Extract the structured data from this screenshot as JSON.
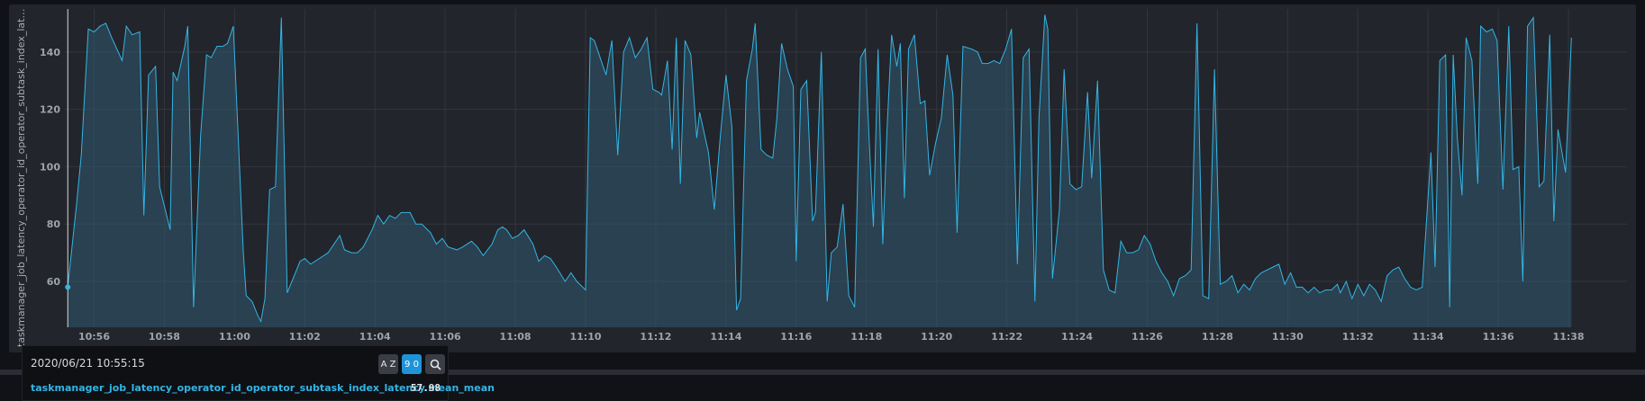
{
  "colors": {
    "line": "#33b5e5",
    "fill": "#2f5a70",
    "grid": "#33363d",
    "background": "#22252b"
  },
  "chart_data": {
    "type": "area",
    "title": "",
    "xlabel": "",
    "ylabel": "taskmanager_job_latency_operator_id_operator_subtask_index_latency.m...",
    "x_ticks": [
      "10:56",
      "10:58",
      "11:00",
      "11:02",
      "11:04",
      "11:06",
      "11:08",
      "11:10",
      "11:12",
      "11:14",
      "11:16",
      "11:18",
      "11:20",
      "11:22",
      "11:24",
      "11:26",
      "11:28",
      "11:30",
      "11:32",
      "11:34",
      "11:36",
      "11:38"
    ],
    "y_ticks": [
      60,
      80,
      100,
      120,
      140
    ],
    "ylim": [
      44,
      155
    ],
    "xlim": [
      "10:55:10",
      "11:39:40"
    ],
    "grid": true,
    "series": [
      {
        "name": "taskmanager_job_latency_operator_id_operator_subtask_index_latency.mean_mean",
        "points": [
          [
            "10:55:15",
            58
          ],
          [
            "10:55:30",
            87
          ],
          [
            "10:55:38",
            104
          ],
          [
            "10:55:50",
            148
          ],
          [
            "10:56:00",
            147
          ],
          [
            "10:56:10",
            149
          ],
          [
            "10:56:20",
            150
          ],
          [
            "10:56:30",
            145
          ],
          [
            "10:56:48",
            137
          ],
          [
            "10:56:55",
            149
          ],
          [
            "10:57:05",
            146
          ],
          [
            "10:57:18",
            147
          ],
          [
            "10:57:25",
            83
          ],
          [
            "10:57:33",
            132
          ],
          [
            "10:57:45",
            135
          ],
          [
            "10:57:52",
            93
          ],
          [
            "10:58:10",
            78
          ],
          [
            "10:58:15",
            133
          ],
          [
            "10:58:22",
            130
          ],
          [
            "10:58:35",
            142
          ],
          [
            "10:58:40",
            149
          ],
          [
            "10:58:50",
            51
          ],
          [
            "10:59:02",
            111
          ],
          [
            "10:59:12",
            139
          ],
          [
            "10:59:20",
            138
          ],
          [
            "10:59:30",
            142
          ],
          [
            "10:59:40",
            142
          ],
          [
            "10:59:48",
            143
          ],
          [
            "10:59:58",
            149
          ],
          [
            "11:00:15",
            70
          ],
          [
            "11:00:20",
            55
          ],
          [
            "11:00:30",
            53
          ],
          [
            "11:00:40",
            48
          ],
          [
            "11:00:45",
            46
          ],
          [
            "11:00:52",
            54
          ],
          [
            "11:01:00",
            92
          ],
          [
            "11:01:10",
            93
          ],
          [
            "11:01:20",
            152
          ],
          [
            "11:01:30",
            56
          ],
          [
            "11:01:40",
            61
          ],
          [
            "11:01:52",
            67
          ],
          [
            "11:02:00",
            68
          ],
          [
            "11:02:10",
            66
          ],
          [
            "11:02:25",
            68
          ],
          [
            "11:02:40",
            70
          ],
          [
            "11:03:00",
            76
          ],
          [
            "11:03:08",
            71
          ],
          [
            "11:03:20",
            70
          ],
          [
            "11:03:30",
            70
          ],
          [
            "11:03:40",
            72
          ],
          [
            "11:03:55",
            78
          ],
          [
            "11:04:05",
            83
          ],
          [
            "11:04:15",
            80
          ],
          [
            "11:04:25",
            83
          ],
          [
            "11:04:35",
            82
          ],
          [
            "11:04:45",
            84
          ],
          [
            "11:05:00",
            84
          ],
          [
            "11:05:10",
            80
          ],
          [
            "11:05:20",
            80
          ],
          [
            "11:05:35",
            77
          ],
          [
            "11:05:45",
            73
          ],
          [
            "11:05:55",
            75
          ],
          [
            "11:06:05",
            72
          ],
          [
            "11:06:20",
            71
          ],
          [
            "11:06:30",
            72
          ],
          [
            "11:06:45",
            74
          ],
          [
            "11:06:55",
            72
          ],
          [
            "11:07:05",
            69
          ],
          [
            "11:07:20",
            73
          ],
          [
            "11:07:30",
            78
          ],
          [
            "11:07:38",
            79
          ],
          [
            "11:07:45",
            78
          ],
          [
            "11:07:55",
            75
          ],
          [
            "11:08:05",
            76
          ],
          [
            "11:08:15",
            78
          ],
          [
            "11:08:30",
            73
          ],
          [
            "11:08:40",
            67
          ],
          [
            "11:08:50",
            69
          ],
          [
            "11:09:00",
            68
          ],
          [
            "11:09:10",
            65
          ],
          [
            "11:09:25",
            60
          ],
          [
            "11:09:35",
            63
          ],
          [
            "11:09:45",
            60
          ],
          [
            "11:10:00",
            57
          ],
          [
            "11:10:08",
            145
          ],
          [
            "11:10:15",
            144
          ],
          [
            "11:10:25",
            138
          ],
          [
            "11:10:35",
            132
          ],
          [
            "11:10:45",
            144
          ],
          [
            "11:10:55",
            104
          ],
          [
            "11:11:05",
            140
          ],
          [
            "11:11:15",
            145
          ],
          [
            "11:11:25",
            138
          ],
          [
            "11:11:35",
            141
          ],
          [
            "11:11:45",
            145
          ],
          [
            "11:11:55",
            127
          ],
          [
            "11:12:05",
            126
          ],
          [
            "11:12:10",
            125
          ],
          [
            "11:12:20",
            137
          ],
          [
            "11:12:28",
            106
          ],
          [
            "11:12:35",
            145
          ],
          [
            "11:12:42",
            94
          ],
          [
            "11:12:50",
            144
          ],
          [
            "11:13:00",
            139
          ],
          [
            "11:13:10",
            110
          ],
          [
            "11:13:15",
            119
          ],
          [
            "11:13:30",
            105
          ],
          [
            "11:13:40",
            85
          ],
          [
            "11:13:50",
            110
          ],
          [
            "11:14:00",
            132
          ],
          [
            "11:14:10",
            114
          ],
          [
            "11:14:18",
            50
          ],
          [
            "11:14:25",
            54
          ],
          [
            "11:14:35",
            130
          ],
          [
            "11:14:45",
            141
          ],
          [
            "11:14:50",
            150
          ],
          [
            "11:15:00",
            106
          ],
          [
            "11:15:10",
            104
          ],
          [
            "11:15:20",
            103
          ],
          [
            "11:15:27",
            117
          ],
          [
            "11:15:35",
            143
          ],
          [
            "11:15:45",
            134
          ],
          [
            "11:15:55",
            128
          ],
          [
            "11:16:00",
            67
          ],
          [
            "11:16:08",
            127
          ],
          [
            "11:16:18",
            130
          ],
          [
            "11:16:28",
            81
          ],
          [
            "11:16:33",
            84
          ],
          [
            "11:16:43",
            140
          ],
          [
            "11:16:53",
            53
          ],
          [
            "11:17:00",
            70
          ],
          [
            "11:17:10",
            72
          ],
          [
            "11:17:20",
            87
          ],
          [
            "11:17:30",
            55
          ],
          [
            "11:17:40",
            51
          ],
          [
            "11:17:50",
            138
          ],
          [
            "11:17:58",
            141
          ],
          [
            "11:18:05",
            108
          ],
          [
            "11:18:12",
            79
          ],
          [
            "11:18:20",
            141
          ],
          [
            "11:18:28",
            73
          ],
          [
            "11:18:35",
            112
          ],
          [
            "11:18:43",
            146
          ],
          [
            "11:18:52",
            135
          ],
          [
            "11:18:58",
            143
          ],
          [
            "11:19:05",
            89
          ],
          [
            "11:19:12",
            141
          ],
          [
            "11:19:22",
            146
          ],
          [
            "11:19:32",
            122
          ],
          [
            "11:19:40",
            123
          ],
          [
            "11:19:48",
            97
          ],
          [
            "11:19:58",
            108
          ],
          [
            "11:20:08",
            117
          ],
          [
            "11:20:18",
            139
          ],
          [
            "11:20:28",
            125
          ],
          [
            "11:20:35",
            77
          ],
          [
            "11:20:45",
            142
          ],
          [
            "11:21:00",
            141
          ],
          [
            "11:21:10",
            140
          ],
          [
            "11:21:18",
            136
          ],
          [
            "11:21:28",
            136
          ],
          [
            "11:21:38",
            137
          ],
          [
            "11:21:48",
            136
          ],
          [
            "11:21:58",
            141
          ],
          [
            "11:22:08",
            148
          ],
          [
            "11:22:18",
            66
          ],
          [
            "11:22:28",
            138
          ],
          [
            "11:22:38",
            141
          ],
          [
            "11:22:48",
            53
          ],
          [
            "11:22:55",
            117
          ],
          [
            "11:23:05",
            153
          ],
          [
            "11:23:10",
            148
          ],
          [
            "11:23:18",
            61
          ],
          [
            "11:23:30",
            85
          ],
          [
            "11:23:38",
            134
          ],
          [
            "11:23:48",
            94
          ],
          [
            "11:23:58",
            92
          ],
          [
            "11:24:08",
            93
          ],
          [
            "11:24:18",
            126
          ],
          [
            "11:24:25",
            96
          ],
          [
            "11:24:35",
            130
          ],
          [
            "11:24:45",
            64
          ],
          [
            "11:24:55",
            57
          ],
          [
            "11:25:05",
            56
          ],
          [
            "11:25:15",
            74
          ],
          [
            "11:25:25",
            70
          ],
          [
            "11:25:35",
            70
          ],
          [
            "11:25:45",
            71
          ],
          [
            "11:25:55",
            76
          ],
          [
            "11:26:05",
            73
          ],
          [
            "11:26:15",
            67
          ],
          [
            "11:26:25",
            63
          ],
          [
            "11:26:35",
            60
          ],
          [
            "11:26:45",
            55
          ],
          [
            "11:26:55",
            61
          ],
          [
            "11:27:05",
            62
          ],
          [
            "11:27:15",
            64
          ],
          [
            "11:27:25",
            150
          ],
          [
            "11:27:35",
            55
          ],
          [
            "11:27:45",
            54
          ],
          [
            "11:27:55",
            134
          ],
          [
            "11:28:05",
            59
          ],
          [
            "11:28:15",
            60
          ],
          [
            "11:28:25",
            62
          ],
          [
            "11:28:35",
            56
          ],
          [
            "11:28:45",
            59
          ],
          [
            "11:28:55",
            57
          ],
          [
            "11:29:05",
            61
          ],
          [
            "11:29:15",
            63
          ],
          [
            "11:29:25",
            64
          ],
          [
            "11:29:35",
            65
          ],
          [
            "11:29:45",
            66
          ],
          [
            "11:29:55",
            59
          ],
          [
            "11:30:05",
            63
          ],
          [
            "11:30:15",
            58
          ],
          [
            "11:30:25",
            58
          ],
          [
            "11:30:35",
            56
          ],
          [
            "11:30:45",
            58
          ],
          [
            "11:30:55",
            56
          ],
          [
            "11:31:05",
            57
          ],
          [
            "11:31:15",
            57
          ],
          [
            "11:31:25",
            59
          ],
          [
            "11:31:30",
            56
          ],
          [
            "11:31:40",
            60
          ],
          [
            "11:31:50",
            54
          ],
          [
            "11:32:00",
            59
          ],
          [
            "11:32:10",
            55
          ],
          [
            "11:32:20",
            59
          ],
          [
            "11:32:30",
            57
          ],
          [
            "11:32:40",
            53
          ],
          [
            "11:32:50",
            62
          ],
          [
            "11:33:00",
            64
          ],
          [
            "11:33:10",
            65
          ],
          [
            "11:33:20",
            61
          ],
          [
            "11:33:30",
            58
          ],
          [
            "11:33:40",
            57
          ],
          [
            "11:33:50",
            58
          ],
          [
            "11:34:05",
            105
          ],
          [
            "11:34:12",
            65
          ],
          [
            "11:34:20",
            137
          ],
          [
            "11:34:30",
            139
          ],
          [
            "11:34:37",
            51
          ],
          [
            "11:34:43",
            139
          ],
          [
            "11:34:50",
            110
          ],
          [
            "11:34:58",
            90
          ],
          [
            "11:35:05",
            145
          ],
          [
            "11:35:15",
            137
          ],
          [
            "11:35:25",
            94
          ],
          [
            "11:35:30",
            149
          ],
          [
            "11:35:40",
            147
          ],
          [
            "11:35:50",
            148
          ],
          [
            "11:35:58",
            144
          ],
          [
            "11:36:08",
            92
          ],
          [
            "11:36:18",
            149
          ],
          [
            "11:36:25",
            99
          ],
          [
            "11:36:35",
            100
          ],
          [
            "11:36:42",
            60
          ],
          [
            "11:36:50",
            149
          ],
          [
            "11:37:00",
            152
          ],
          [
            "11:37:10",
            93
          ],
          [
            "11:37:18",
            95
          ],
          [
            "11:37:28",
            146
          ],
          [
            "11:37:35",
            81
          ],
          [
            "11:37:42",
            113
          ],
          [
            "11:37:55",
            98
          ],
          [
            "11:38:05",
            145
          ]
        ]
      }
    ]
  },
  "tooltip": {
    "time": "2020/06/21 10:55:15",
    "sort_alpha_label": "A Z",
    "sort_value_label": "9 0",
    "series_name": "taskmanager_job_latency_operator_id_operator_subtask_index_latency.mean_mean",
    "value": "57.98"
  }
}
